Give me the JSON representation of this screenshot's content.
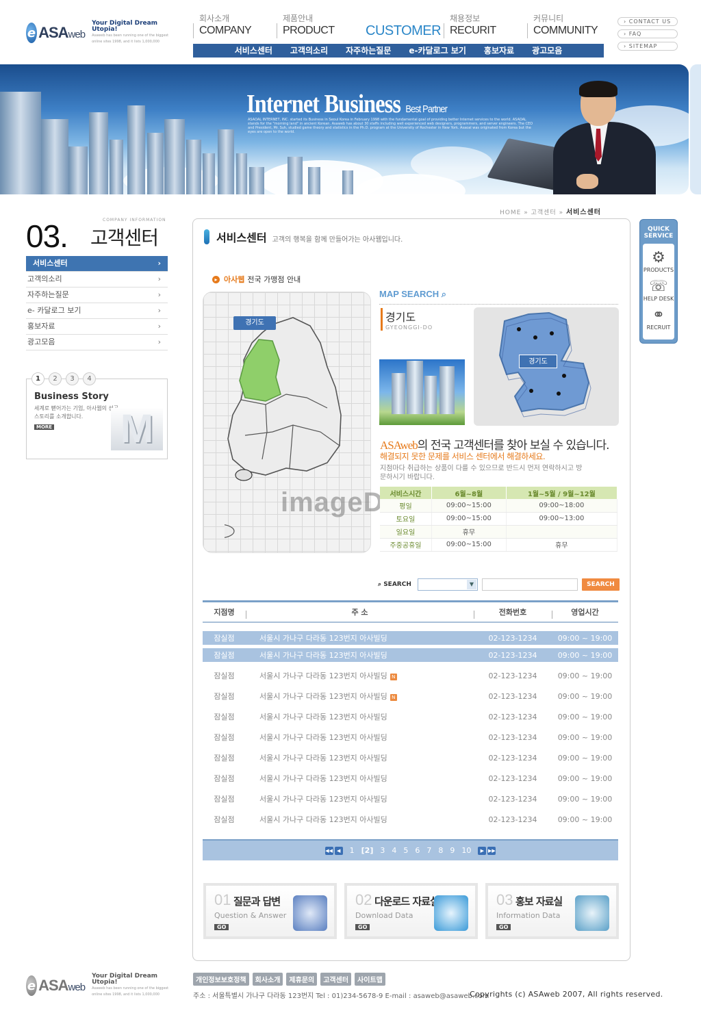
{
  "brand": {
    "logo_text": "ASA",
    "logo_sub": "web",
    "slogan_title": "Your Digital Dream Utopia!",
    "slogan_desc": "Asaweb has been running one of the biggest online sites 1998, and it lists 1,000,000"
  },
  "gnb": [
    {
      "ko": "회사소개",
      "en": "COMPANY",
      "active": false
    },
    {
      "ko": "제품안내",
      "en": "PRODUCT",
      "active": false
    },
    {
      "ko": "",
      "en": "CUSTOMER",
      "active": true
    },
    {
      "ko": "채용정보",
      "en": "RECURIT",
      "active": false
    },
    {
      "ko": "커뮤니티",
      "en": "COMMUNITY",
      "active": false
    }
  ],
  "subnav": [
    "서비스센터",
    "고객의소리",
    "자주하는질문",
    "e-카달로그 보기",
    "홍보자료",
    "광고모음"
  ],
  "util": [
    "CONTACT US",
    "FAQ",
    "SITEMAP"
  ],
  "banner": {
    "title": "Internet Business",
    "title_sub": "Best Partner",
    "desc": "ASAOAL INTERNET, INC. started its Business in Seoul Korea in February 1998 with the fundamental goal of providing better Internet services to the world. ASAOAL stands for the \"morning land\" in ancient Korean. Asaweb has about 30 staffs including well experienced web designers, programmers, and server engineers. The CEO and President, Mr. Suh, studied game theory and statistics in the Ph.D. program at the University of Rochester in New York. Asaoal was originated from Korea but the eyes are open to the world."
  },
  "section": {
    "num": "03.",
    "title": "고객센터",
    "eng": "COMPANY INFORMATION"
  },
  "lnb": [
    {
      "label": "서비스센터",
      "active": true
    },
    {
      "label": "고객의소리",
      "active": false
    },
    {
      "label": "자주하는질문",
      "active": false
    },
    {
      "label": "e- 카달로그 보기",
      "active": false
    },
    {
      "label": "홍보자료",
      "active": false
    },
    {
      "label": "광고모음",
      "active": false
    }
  ],
  "story": {
    "dots": [
      "1",
      "2",
      "3",
      "4"
    ],
    "title": "Business Story",
    "desc": "세계로 뻗어가는 기업, 아사웹의 성공 스토리를 소개합니다.",
    "more": "MORE"
  },
  "breadcrumb": {
    "home": "HOME",
    "sep": "»",
    "mid": "고객센터",
    "current": "서비스센터"
  },
  "page": {
    "title": "서비스센터",
    "desc": "고객의 행복을 함께 만들어가는 아사웹입니다."
  },
  "branch_intro": {
    "highlight": "아사웹",
    "text": "전국 가맹점 안내"
  },
  "map": {
    "badge": "경기도",
    "watermark": "imageDJ"
  },
  "map_search": {
    "label": "MAP SEARCH",
    "region_ko": "경기도",
    "region_en": "GYEONGGI-DO",
    "region_badge": "경기도"
  },
  "cs": {
    "head_brand": "ASAweb",
    "head_text": "의 전국 고객센터를 찾아 보실 수 있습니다.",
    "sub": "해결되지 못한 문제를 서비스 센터에서 해결하세요.",
    "note": "지점마다 취급하는 상품이 다를 수 있으므로 반드시 먼저 연락하시고 방문하시기 바랍니다."
  },
  "hours": {
    "headers": [
      "서비스시간",
      "6월~8월",
      "1월~5월 / 9월~12월"
    ],
    "rows": [
      [
        "평일",
        "09:00~15:00",
        "09:00~18:00"
      ],
      [
        "토요일",
        "09:00~15:00",
        "09:00~13:00"
      ],
      [
        "일요일",
        "휴무",
        ""
      ],
      [
        "주중공휴일",
        "09:00~15:00",
        "휴무"
      ]
    ]
  },
  "search": {
    "label": "SEARCH",
    "select": "",
    "input": "",
    "button": "SEARCH"
  },
  "list": {
    "headers": [
      "지점명",
      "주 소",
      "전화번호",
      "영업시간"
    ],
    "rows": [
      {
        "name": "잠실점",
        "addr": "서울시 가나구 다라동 123번지 아사빌딩",
        "tel": "02-123-1234",
        "time": "09:00 ~ 19:00",
        "hl": true,
        "new": false
      },
      {
        "name": "잠실점",
        "addr": "서울시 가나구 다라동 123번지 아사빌딩",
        "tel": "02-123-1234",
        "time": "09:00 ~ 19:00",
        "hl": true,
        "new": false
      },
      {
        "name": "잠실점",
        "addr": "서울시 가나구 다라동 123번지 아사빌딩",
        "tel": "02-123-1234",
        "time": "09:00 ~ 19:00",
        "hl": false,
        "new": true
      },
      {
        "name": "잠실점",
        "addr": "서울시 가나구 다라동 123번지 아사빌딩",
        "tel": "02-123-1234",
        "time": "09:00 ~ 19:00",
        "hl": false,
        "new": true
      },
      {
        "name": "잠실점",
        "addr": "서울시 가나구 다라동 123번지 아사빌딩",
        "tel": "02-123-1234",
        "time": "09:00 ~ 19:00",
        "hl": false,
        "new": false
      },
      {
        "name": "잠실점",
        "addr": "서울시 가나구 다라동 123번지 아사빌딩",
        "tel": "02-123-1234",
        "time": "09:00 ~ 19:00",
        "hl": false,
        "new": false
      },
      {
        "name": "잠실점",
        "addr": "서울시 가나구 다라동 123번지 아사빌딩",
        "tel": "02-123-1234",
        "time": "09:00 ~ 19:00",
        "hl": false,
        "new": false
      },
      {
        "name": "잠실점",
        "addr": "서울시 가나구 다라동 123번지 아사빌딩",
        "tel": "02-123-1234",
        "time": "09:00 ~ 19:00",
        "hl": false,
        "new": false
      },
      {
        "name": "잠실점",
        "addr": "서울시 가나구 다라동 123번지 아사빌딩",
        "tel": "02-123-1234",
        "time": "09:00 ~ 19:00",
        "hl": false,
        "new": false
      },
      {
        "name": "잠실점",
        "addr": "서울시 가나구 다라동 123번지 아사빌딩",
        "tel": "02-123-1234",
        "time": "09:00 ~ 19:00",
        "hl": false,
        "new": false
      }
    ],
    "new_icon": "N"
  },
  "pager": {
    "pages": [
      "1",
      "[2]",
      "3",
      "4",
      "5",
      "6",
      "7",
      "8",
      "9",
      "10"
    ],
    "current": "[2]"
  },
  "cards": [
    {
      "num": "01",
      "title": "질문과 답변",
      "en": "Question & Answer",
      "go": "GO",
      "icon": "qna-icon",
      "color": "#5a7fc0"
    },
    {
      "num": "02",
      "title": "다운로드 자료실",
      "en": "Download Data",
      "go": "GO",
      "icon": "download-icon",
      "color": "#3a9ad8"
    },
    {
      "num": "03",
      "title": "홍보 자료실",
      "en": "Information Data",
      "go": "GO",
      "icon": "folder-icon",
      "color": "#5aa0c8"
    }
  ],
  "quick": {
    "title": "QUICK SERVICE",
    "items": [
      {
        "label": "PRODUCTS",
        "icon": "gear-icon"
      },
      {
        "label": "HELP DESK",
        "icon": "phone-icon"
      },
      {
        "label": "RECRUIT",
        "icon": "people-icon"
      }
    ]
  },
  "footer": {
    "links": [
      "개인정보보호정책",
      "회사소개",
      "제휴문의",
      "고객센터",
      "사이트맵"
    ],
    "address": "주소 : 서울특별시 가나구 다라동 123번지   Tel : 01)234-5678-9   E-mail : asaweb@asaweb.com",
    "copyright": "Copyrights (c) ASAweb 2007, All rights reserved."
  },
  "colors": {
    "accent": "#2f5f9c",
    "orange": "#e67a1b",
    "green": "#8fcf6a",
    "map_blue": "#6f9ad3"
  }
}
